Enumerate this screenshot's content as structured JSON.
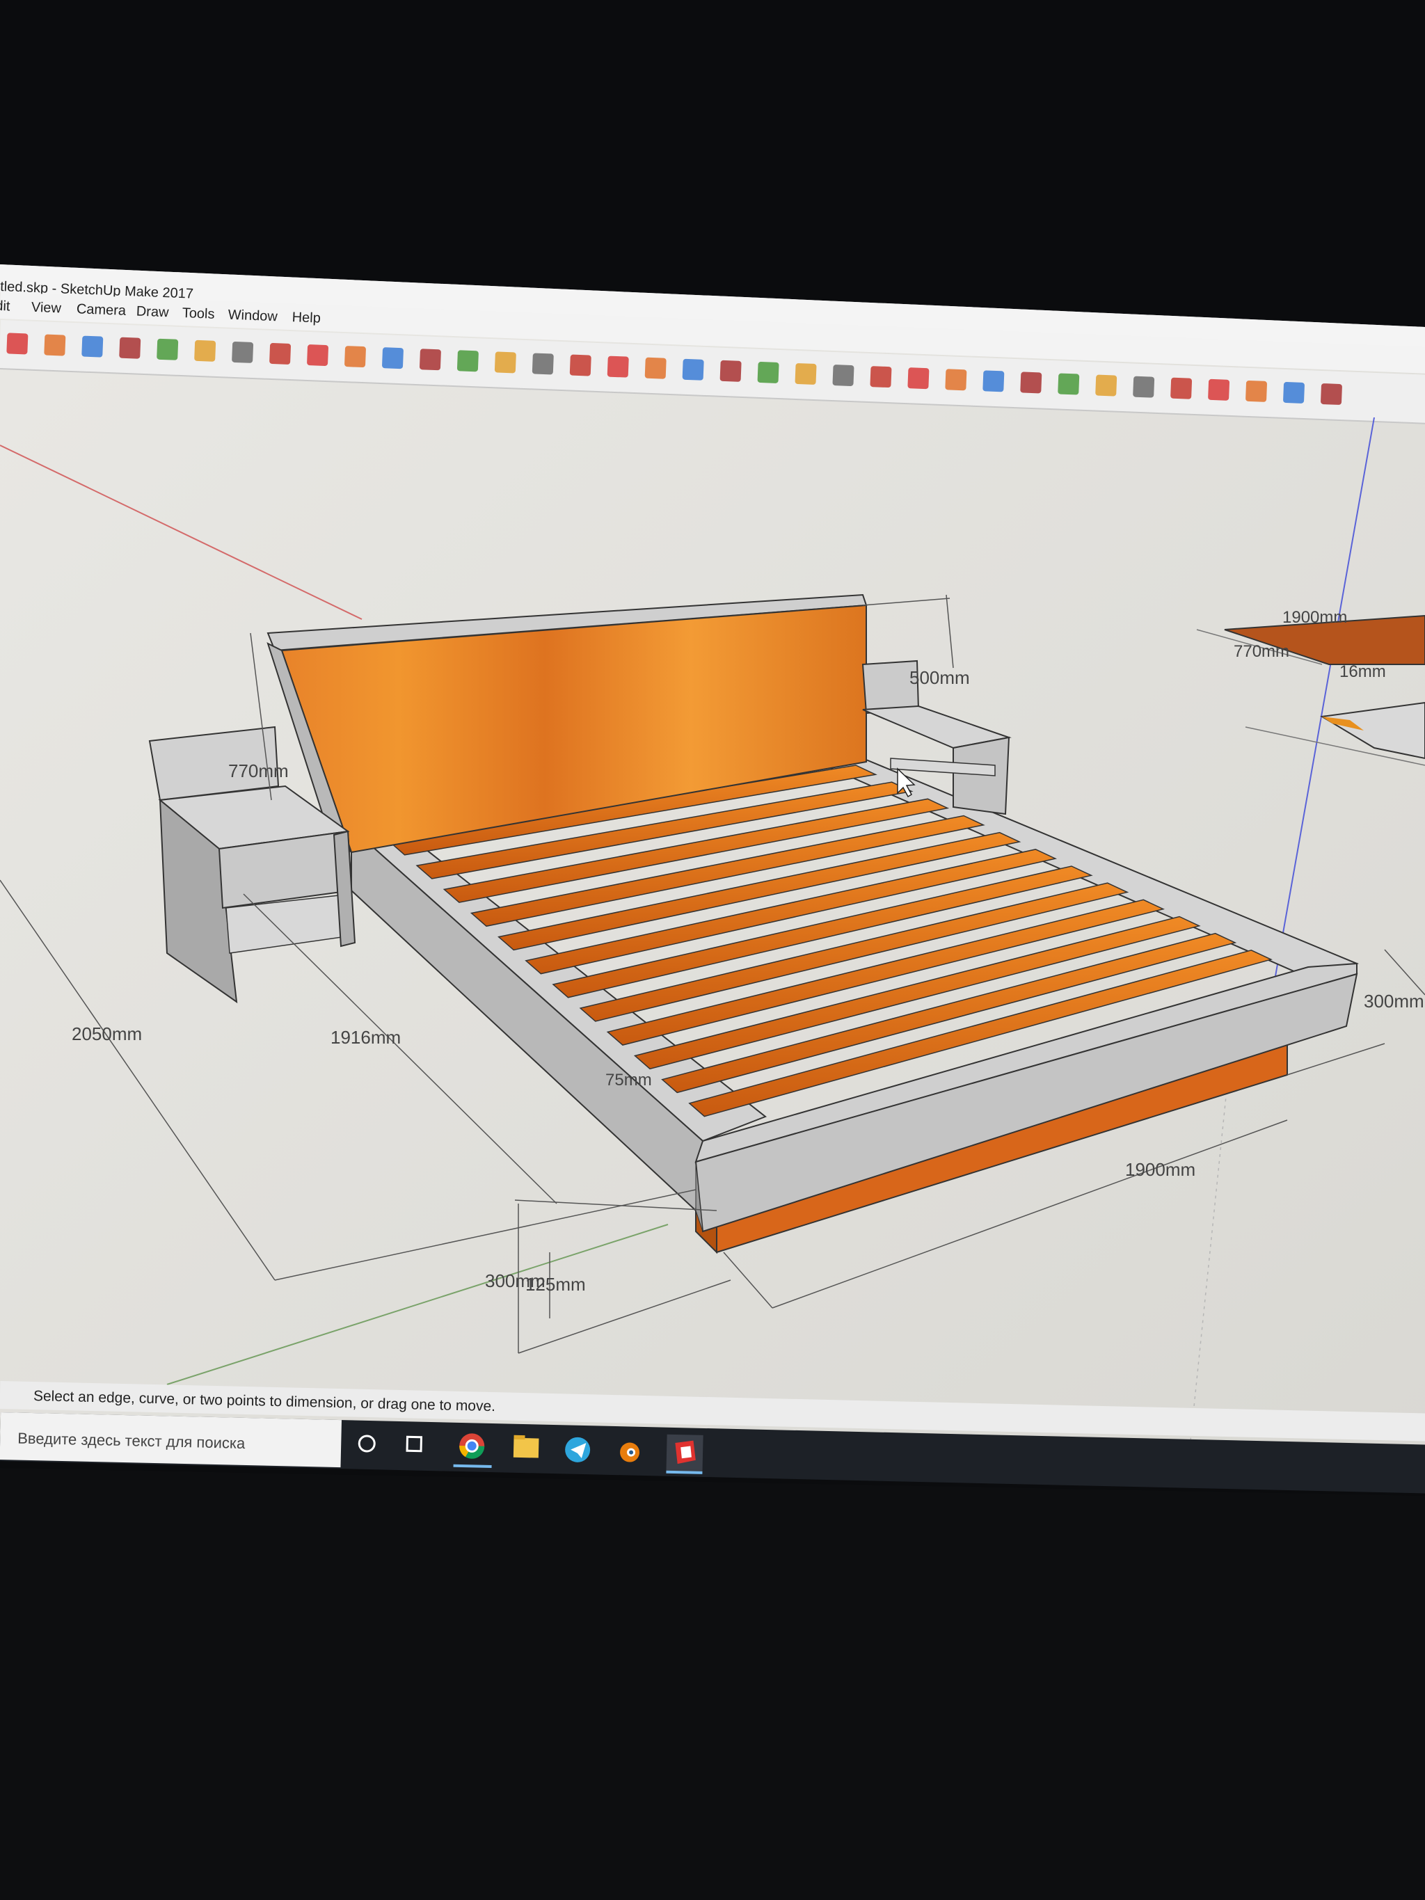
{
  "window": {
    "title": "tled.skp - SketchUp Make 2017"
  },
  "menu": [
    "Edit",
    "View",
    "Camera",
    "Draw",
    "Tools",
    "Window",
    "Help"
  ],
  "toolbar": {
    "tools": [
      "select-tool",
      "eraser-tool",
      "pencil-tool",
      "line-dropdown",
      "arc-tool",
      "arc-dropdown",
      "rectangle-tool",
      "shape-dropdown",
      "push-pull-tool",
      "follow-me-tool",
      "move-tool",
      "rotate-tool",
      "scale-tool",
      "tape-measure-tool",
      "text-tool",
      "paint-bucket-tool",
      "orbit-tool",
      "pan-tool",
      "zoom-tool",
      "zoom-extents-tool",
      "warehouse-tool",
      "extension-warehouse-tool",
      "layout-tool",
      "ruby-tool",
      "dimension-tape-tool",
      "dimension-tool",
      "protractor-tool",
      "text-label-tool",
      "axes-tool",
      "3d-text-tool",
      "iso-view",
      "top-view",
      "front-view",
      "right-view",
      "back-view",
      "left-view"
    ]
  },
  "dimensions": {
    "headboard_height": "500mm",
    "nightstand_height": "770mm",
    "bed_length": "2050mm",
    "inner_length": "1916mm",
    "rail_width": "75mm",
    "bed_width": "1900mm",
    "base_height": "300mm",
    "base_offset": "125mm",
    "side_height": "300mm",
    "detail_width": "1900mm",
    "detail_height": "770mm",
    "detail_depth": "16mm"
  },
  "status": {
    "hint": "Select an edge, curve, or two points to dimension, or drag one to move."
  },
  "taskbar": {
    "search_placeholder": "Введите здесь текст для поиска",
    "apps": [
      "cortana-icon",
      "task-view-icon",
      "chrome-icon",
      "file-explorer-icon",
      "telegram-icon",
      "blender-icon",
      "sketchup-icon"
    ]
  },
  "colors": {
    "wood": "#e07a1c",
    "viewport": "#e6e5e1",
    "panel": "#c9c9c9",
    "accent_blue": "#3f8be0"
  }
}
